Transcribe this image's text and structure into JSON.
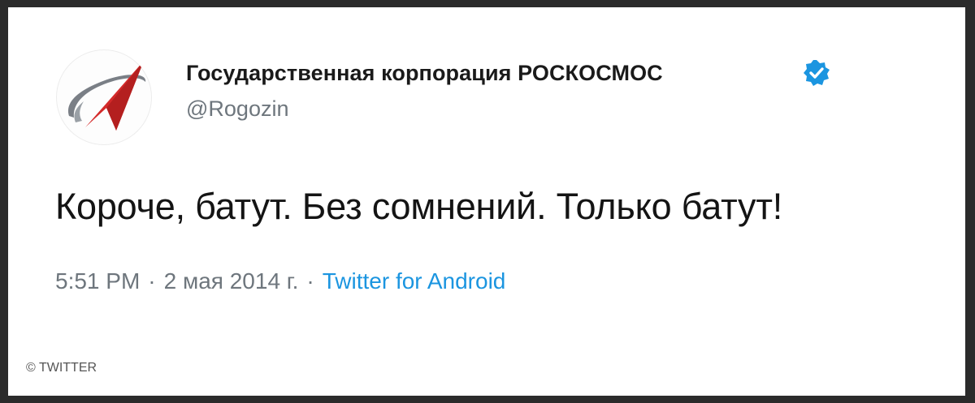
{
  "tweet": {
    "avatar_icon": "roscosmos-logo-icon",
    "display_name": "Государственная корпорация РОСКОСМОС",
    "verified_icon": "verified-badge-icon",
    "handle": "@Rogozin",
    "text": "Короче, батут. Без сомнений. Только батут!",
    "time": "5:51 PM",
    "date": "2 мая 2014 г.",
    "separator": "·",
    "source": "Twitter for Android"
  },
  "credit": "© TWITTER",
  "colors": {
    "accent": "#1b95e0",
    "logo_red": "#d42a2a",
    "logo_gray": "#7a7f86",
    "secondary_text": "#6e767d",
    "frame": "#2b2b2b"
  }
}
